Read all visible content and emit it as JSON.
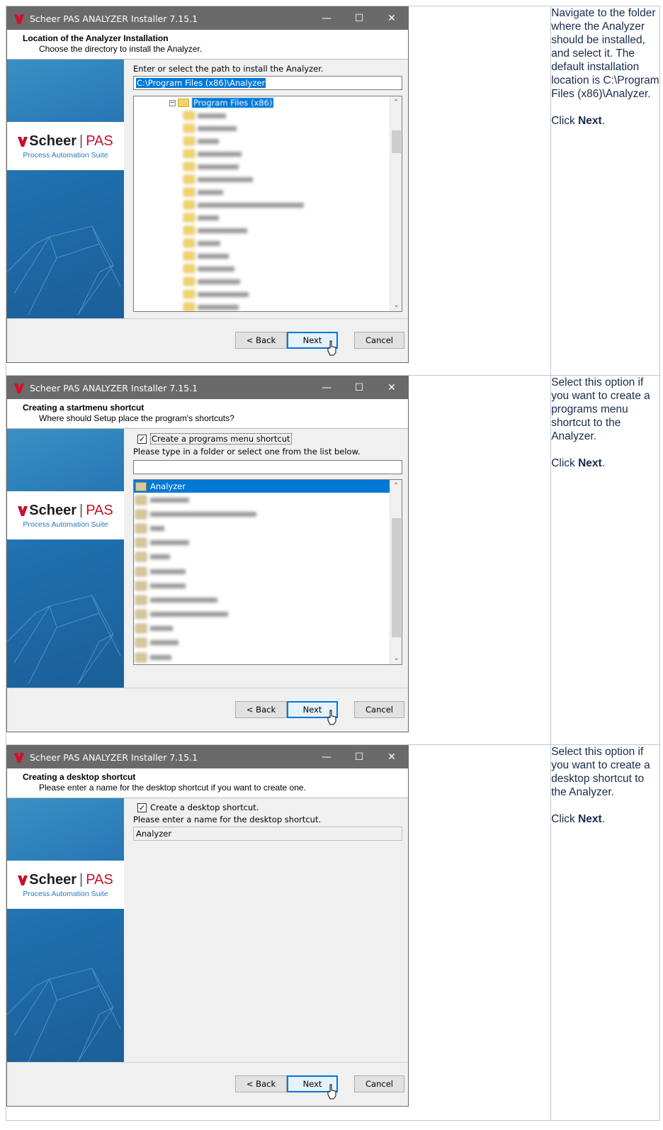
{
  "window": {
    "title": "Scheer PAS ANALYZER Installer 7.15.1",
    "minimize_glyph": "—",
    "maximize_glyph": "☐",
    "close_glyph": "✕"
  },
  "brand": {
    "name_bold": "Scheer",
    "divider": "|",
    "name_accent": "PAS",
    "tagline": "Process Automation Suite",
    "accent_color": "#c8102e",
    "banner_color": "#1f6fae"
  },
  "buttons": {
    "back": "< Back",
    "next": "Next",
    "cancel": "Cancel"
  },
  "step1": {
    "heading": "Location of the Analyzer Installation",
    "subheading": "Choose the directory to install the Analyzer.",
    "path_label": "Enter or select the path to install the Analyzer.",
    "path_value": "C:\\Program Files (x86)\\Analyzer",
    "tree_root": "Program Files (x86)",
    "note_text": "Navigate to the folder where the Analyzer should be installed, and select it. The default installation location is C:\\Program Files (x86)\\Analyzer.",
    "note_click": "Click ",
    "note_next": "Next",
    "note_period": "."
  },
  "step2": {
    "heading": "Creating a startmenu shortcut",
    "subheading": "Where should Setup place the program's shortcuts?",
    "checkbox_label": "Create a programs menu shortcut",
    "folder_label": "Please type in a folder or select one from the list below.",
    "folder_value": "",
    "selected_folder": "Analyzer",
    "note_text": "Select this option if you want to create a programs menu shortcut to the Analyzer.",
    "note_click": "Click ",
    "note_next": "Next",
    "note_period": "."
  },
  "step3": {
    "heading": "Creating a desktop shortcut",
    "subheading": "Please enter a name for the desktop shortcut if you want to create one.",
    "checkbox_label": "Create a desktop shortcut.",
    "name_label": "Please enter a name for the desktop shortcut.",
    "name_value": "Analyzer",
    "note_text": "Select this option if you want to create a desktop shortcut to the Analyzer.",
    "note_click": "Click ",
    "note_next": "Next",
    "note_period": "."
  }
}
